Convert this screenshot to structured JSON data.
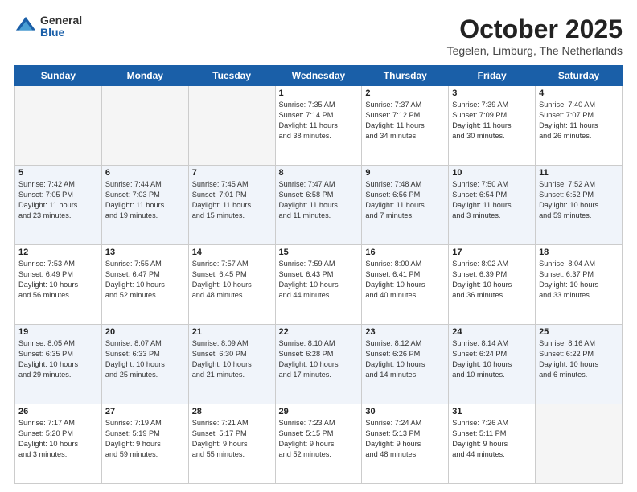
{
  "logo": {
    "general": "General",
    "blue": "Blue"
  },
  "title": "October 2025",
  "subtitle": "Tegelen, Limburg, The Netherlands",
  "days_of_week": [
    "Sunday",
    "Monday",
    "Tuesday",
    "Wednesday",
    "Thursday",
    "Friday",
    "Saturday"
  ],
  "weeks": [
    [
      {
        "day": "",
        "info": ""
      },
      {
        "day": "",
        "info": ""
      },
      {
        "day": "",
        "info": ""
      },
      {
        "day": "1",
        "info": "Sunrise: 7:35 AM\nSunset: 7:14 PM\nDaylight: 11 hours\nand 38 minutes."
      },
      {
        "day": "2",
        "info": "Sunrise: 7:37 AM\nSunset: 7:12 PM\nDaylight: 11 hours\nand 34 minutes."
      },
      {
        "day": "3",
        "info": "Sunrise: 7:39 AM\nSunset: 7:09 PM\nDaylight: 11 hours\nand 30 minutes."
      },
      {
        "day": "4",
        "info": "Sunrise: 7:40 AM\nSunset: 7:07 PM\nDaylight: 11 hours\nand 26 minutes."
      }
    ],
    [
      {
        "day": "5",
        "info": "Sunrise: 7:42 AM\nSunset: 7:05 PM\nDaylight: 11 hours\nand 23 minutes."
      },
      {
        "day": "6",
        "info": "Sunrise: 7:44 AM\nSunset: 7:03 PM\nDaylight: 11 hours\nand 19 minutes."
      },
      {
        "day": "7",
        "info": "Sunrise: 7:45 AM\nSunset: 7:01 PM\nDaylight: 11 hours\nand 15 minutes."
      },
      {
        "day": "8",
        "info": "Sunrise: 7:47 AM\nSunset: 6:58 PM\nDaylight: 11 hours\nand 11 minutes."
      },
      {
        "day": "9",
        "info": "Sunrise: 7:48 AM\nSunset: 6:56 PM\nDaylight: 11 hours\nand 7 minutes."
      },
      {
        "day": "10",
        "info": "Sunrise: 7:50 AM\nSunset: 6:54 PM\nDaylight: 11 hours\nand 3 minutes."
      },
      {
        "day": "11",
        "info": "Sunrise: 7:52 AM\nSunset: 6:52 PM\nDaylight: 10 hours\nand 59 minutes."
      }
    ],
    [
      {
        "day": "12",
        "info": "Sunrise: 7:53 AM\nSunset: 6:49 PM\nDaylight: 10 hours\nand 56 minutes."
      },
      {
        "day": "13",
        "info": "Sunrise: 7:55 AM\nSunset: 6:47 PM\nDaylight: 10 hours\nand 52 minutes."
      },
      {
        "day": "14",
        "info": "Sunrise: 7:57 AM\nSunset: 6:45 PM\nDaylight: 10 hours\nand 48 minutes."
      },
      {
        "day": "15",
        "info": "Sunrise: 7:59 AM\nSunset: 6:43 PM\nDaylight: 10 hours\nand 44 minutes."
      },
      {
        "day": "16",
        "info": "Sunrise: 8:00 AM\nSunset: 6:41 PM\nDaylight: 10 hours\nand 40 minutes."
      },
      {
        "day": "17",
        "info": "Sunrise: 8:02 AM\nSunset: 6:39 PM\nDaylight: 10 hours\nand 36 minutes."
      },
      {
        "day": "18",
        "info": "Sunrise: 8:04 AM\nSunset: 6:37 PM\nDaylight: 10 hours\nand 33 minutes."
      }
    ],
    [
      {
        "day": "19",
        "info": "Sunrise: 8:05 AM\nSunset: 6:35 PM\nDaylight: 10 hours\nand 29 minutes."
      },
      {
        "day": "20",
        "info": "Sunrise: 8:07 AM\nSunset: 6:33 PM\nDaylight: 10 hours\nand 25 minutes."
      },
      {
        "day": "21",
        "info": "Sunrise: 8:09 AM\nSunset: 6:30 PM\nDaylight: 10 hours\nand 21 minutes."
      },
      {
        "day": "22",
        "info": "Sunrise: 8:10 AM\nSunset: 6:28 PM\nDaylight: 10 hours\nand 17 minutes."
      },
      {
        "day": "23",
        "info": "Sunrise: 8:12 AM\nSunset: 6:26 PM\nDaylight: 10 hours\nand 14 minutes."
      },
      {
        "day": "24",
        "info": "Sunrise: 8:14 AM\nSunset: 6:24 PM\nDaylight: 10 hours\nand 10 minutes."
      },
      {
        "day": "25",
        "info": "Sunrise: 8:16 AM\nSunset: 6:22 PM\nDaylight: 10 hours\nand 6 minutes."
      }
    ],
    [
      {
        "day": "26",
        "info": "Sunrise: 7:17 AM\nSunset: 5:20 PM\nDaylight: 10 hours\nand 3 minutes."
      },
      {
        "day": "27",
        "info": "Sunrise: 7:19 AM\nSunset: 5:19 PM\nDaylight: 9 hours\nand 59 minutes."
      },
      {
        "day": "28",
        "info": "Sunrise: 7:21 AM\nSunset: 5:17 PM\nDaylight: 9 hours\nand 55 minutes."
      },
      {
        "day": "29",
        "info": "Sunrise: 7:23 AM\nSunset: 5:15 PM\nDaylight: 9 hours\nand 52 minutes."
      },
      {
        "day": "30",
        "info": "Sunrise: 7:24 AM\nSunset: 5:13 PM\nDaylight: 9 hours\nand 48 minutes."
      },
      {
        "day": "31",
        "info": "Sunrise: 7:26 AM\nSunset: 5:11 PM\nDaylight: 9 hours\nand 44 minutes."
      },
      {
        "day": "",
        "info": ""
      }
    ]
  ]
}
